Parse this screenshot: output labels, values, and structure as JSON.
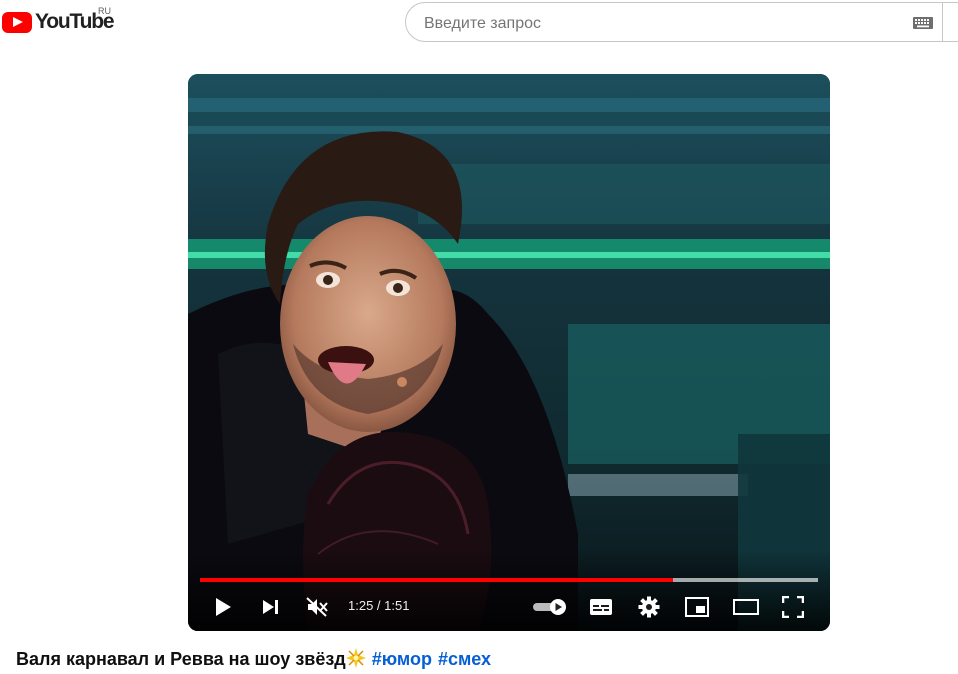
{
  "header": {
    "logo_text": "YouTube",
    "country_code": "RU",
    "search_placeholder": "Введите запрос"
  },
  "player": {
    "current_time": "1:25",
    "duration": "1:51",
    "time_display": "1:25 / 1:51",
    "progress_fraction": 0.766,
    "buffered_fraction": 1.0,
    "muted": true,
    "autoplay_on": true,
    "controls": [
      "play-icon",
      "next-icon",
      "volume-muted-icon",
      "autoplay-toggle",
      "subtitles-icon",
      "settings-icon",
      "miniplayer-icon",
      "theater-mode-icon",
      "fullscreen-icon"
    ]
  },
  "video": {
    "title": "Валя карнавал и Ревва на шоу звёзд",
    "title_emoji": "sparkle-icon",
    "hashtags": [
      "#юмор",
      "#смех"
    ]
  },
  "colors": {
    "brand_red": "#ff0000",
    "link_blue": "#065fd4",
    "progress_red": "#ff0000"
  }
}
